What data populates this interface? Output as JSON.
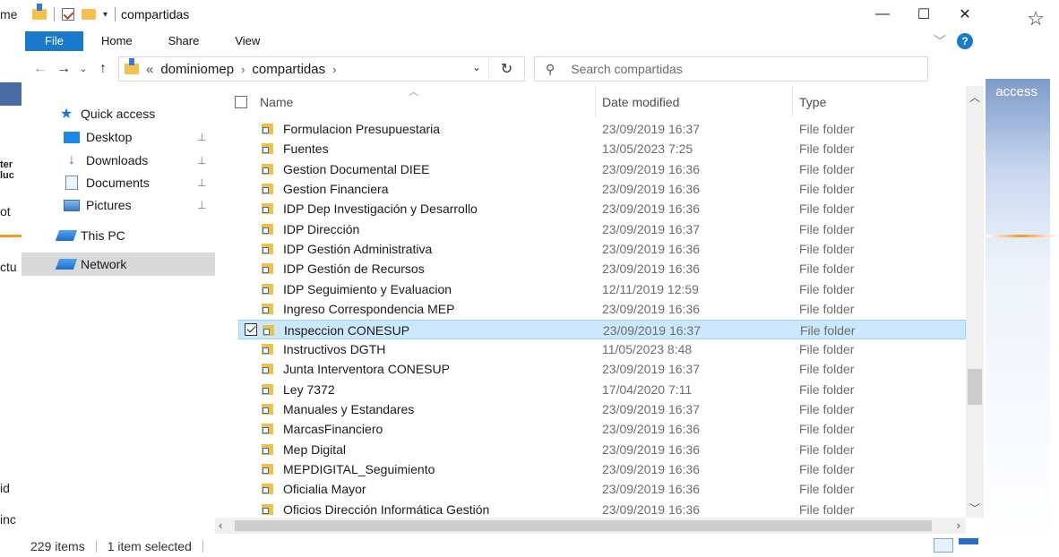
{
  "background_app": {
    "left_fragments": [
      "me",
      "ter",
      "luc",
      "ot",
      "ctu",
      "id",
      "inc"
    ],
    "right_label": "access",
    "star_icon": "star-icon"
  },
  "window": {
    "title": "compartidas",
    "controls": {
      "minimize": "—",
      "maximize": "☐",
      "close": "✕"
    }
  },
  "ribbon": {
    "tabs": [
      "File",
      "Home",
      "Share",
      "View"
    ],
    "help": "?"
  },
  "address": {
    "back": "←",
    "forward": "→",
    "recent": "⌄",
    "up": "↑",
    "overflow": "«",
    "crumbs": [
      "dominiomep",
      "compartidas"
    ],
    "separator": "›",
    "dropdown": "⌄",
    "refresh": "↻"
  },
  "search": {
    "placeholder": "Search compartidas"
  },
  "nav": {
    "items": [
      {
        "label": "Quick access",
        "icon": "star-icon",
        "pinned": false
      },
      {
        "label": "Desktop",
        "icon": "desktop-icon",
        "pinned": true
      },
      {
        "label": "Downloads",
        "icon": "download-icon",
        "pinned": true
      },
      {
        "label": "Documents",
        "icon": "documents-icon",
        "pinned": true
      },
      {
        "label": "Pictures",
        "icon": "pictures-icon",
        "pinned": true
      },
      {
        "label": "This PC",
        "icon": "computer-icon",
        "pinned": false
      },
      {
        "label": "Network",
        "icon": "network-icon",
        "pinned": false,
        "selected": true
      }
    ],
    "pin_glyph": "📌"
  },
  "columns": {
    "name": "Name",
    "date": "Date modified",
    "type": "Type"
  },
  "files": [
    {
      "name": "Formulacion Presupuestaria",
      "date": "23/09/2019 16:37",
      "type": "File folder"
    },
    {
      "name": "Fuentes",
      "date": "13/05/2023 7:25",
      "type": "File folder"
    },
    {
      "name": "Gestion Documental DIEE",
      "date": "23/09/2019 16:36",
      "type": "File folder"
    },
    {
      "name": "Gestion Financiera",
      "date": "23/09/2019 16:36",
      "type": "File folder"
    },
    {
      "name": "IDP Dep Investigación y Desarrollo",
      "date": "23/09/2019 16:36",
      "type": "File folder"
    },
    {
      "name": "IDP Dirección",
      "date": "23/09/2019 16:37",
      "type": "File folder"
    },
    {
      "name": "IDP Gestión Administrativa",
      "date": "23/09/2019 16:36",
      "type": "File folder"
    },
    {
      "name": "IDP Gestión de Recursos",
      "date": "23/09/2019 16:36",
      "type": "File folder"
    },
    {
      "name": "IDP Seguimiento y Evaluacion",
      "date": "12/11/2019 12:59",
      "type": "File folder"
    },
    {
      "name": "Ingreso Correspondencia MEP",
      "date": "23/09/2019 16:36",
      "type": "File folder"
    },
    {
      "name": "Inspeccion CONESUP",
      "date": "23/09/2019 16:37",
      "type": "File folder",
      "selected": true
    },
    {
      "name": "Instructivos DGTH",
      "date": "11/05/2023 8:48",
      "type": "File folder"
    },
    {
      "name": "Junta Interventora CONESUP",
      "date": "23/09/2019 16:37",
      "type": "File folder"
    },
    {
      "name": "Ley 7372",
      "date": "17/04/2020 7:11",
      "type": "File folder"
    },
    {
      "name": "Manuales y Estandares",
      "date": "23/09/2019 16:37",
      "type": "File folder"
    },
    {
      "name": "MarcasFinanciero",
      "date": "23/09/2019 16:36",
      "type": "File folder"
    },
    {
      "name": "Mep Digital",
      "date": "23/09/2019 16:36",
      "type": "File folder"
    },
    {
      "name": "MEPDIGITAL_Seguimiento",
      "date": "23/09/2019 16:36",
      "type": "File folder"
    },
    {
      "name": "Oficialia Mayor",
      "date": "23/09/2019 16:36",
      "type": "File folder"
    },
    {
      "name": "Oficios Dirección Informática Gestión",
      "date": "23/09/2019 16:36",
      "type": "File folder"
    }
  ],
  "status": {
    "count": "229 items",
    "selection": "1 item selected"
  },
  "colors": {
    "accent": "#1979ca",
    "selection": "#cce8ff",
    "folder": "#f1c04b"
  }
}
